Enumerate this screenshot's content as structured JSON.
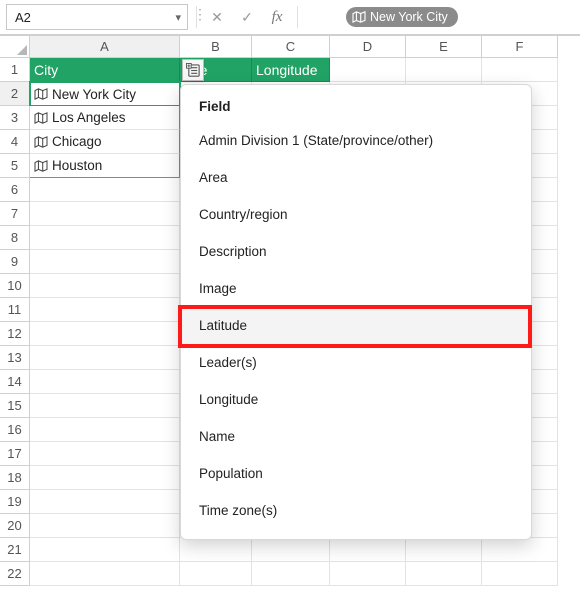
{
  "formula_bar": {
    "cell_ref": "A2",
    "chip_label": "New York City"
  },
  "columns": [
    "A",
    "B",
    "C",
    "D",
    "E",
    "F"
  ],
  "headers": {
    "A": "City",
    "B": "ude",
    "C": "Longitude"
  },
  "data_rows": [
    "New York City",
    "Los Angeles",
    "Chicago",
    "Houston"
  ],
  "row_numbers": [
    "1",
    "2",
    "3",
    "4",
    "5",
    "6",
    "7",
    "8",
    "9",
    "10",
    "11",
    "12",
    "13",
    "14",
    "15",
    "16",
    "17",
    "18",
    "19",
    "20",
    "21",
    "22"
  ],
  "field_menu": {
    "title": "Field",
    "items": [
      "Admin Division 1 (State/province/other)",
      "Area",
      "Country/region",
      "Description",
      "Image",
      "Latitude",
      "Leader(s)",
      "Longitude",
      "Name",
      "Population",
      "Time zone(s)"
    ],
    "highlighted_index": 5
  }
}
